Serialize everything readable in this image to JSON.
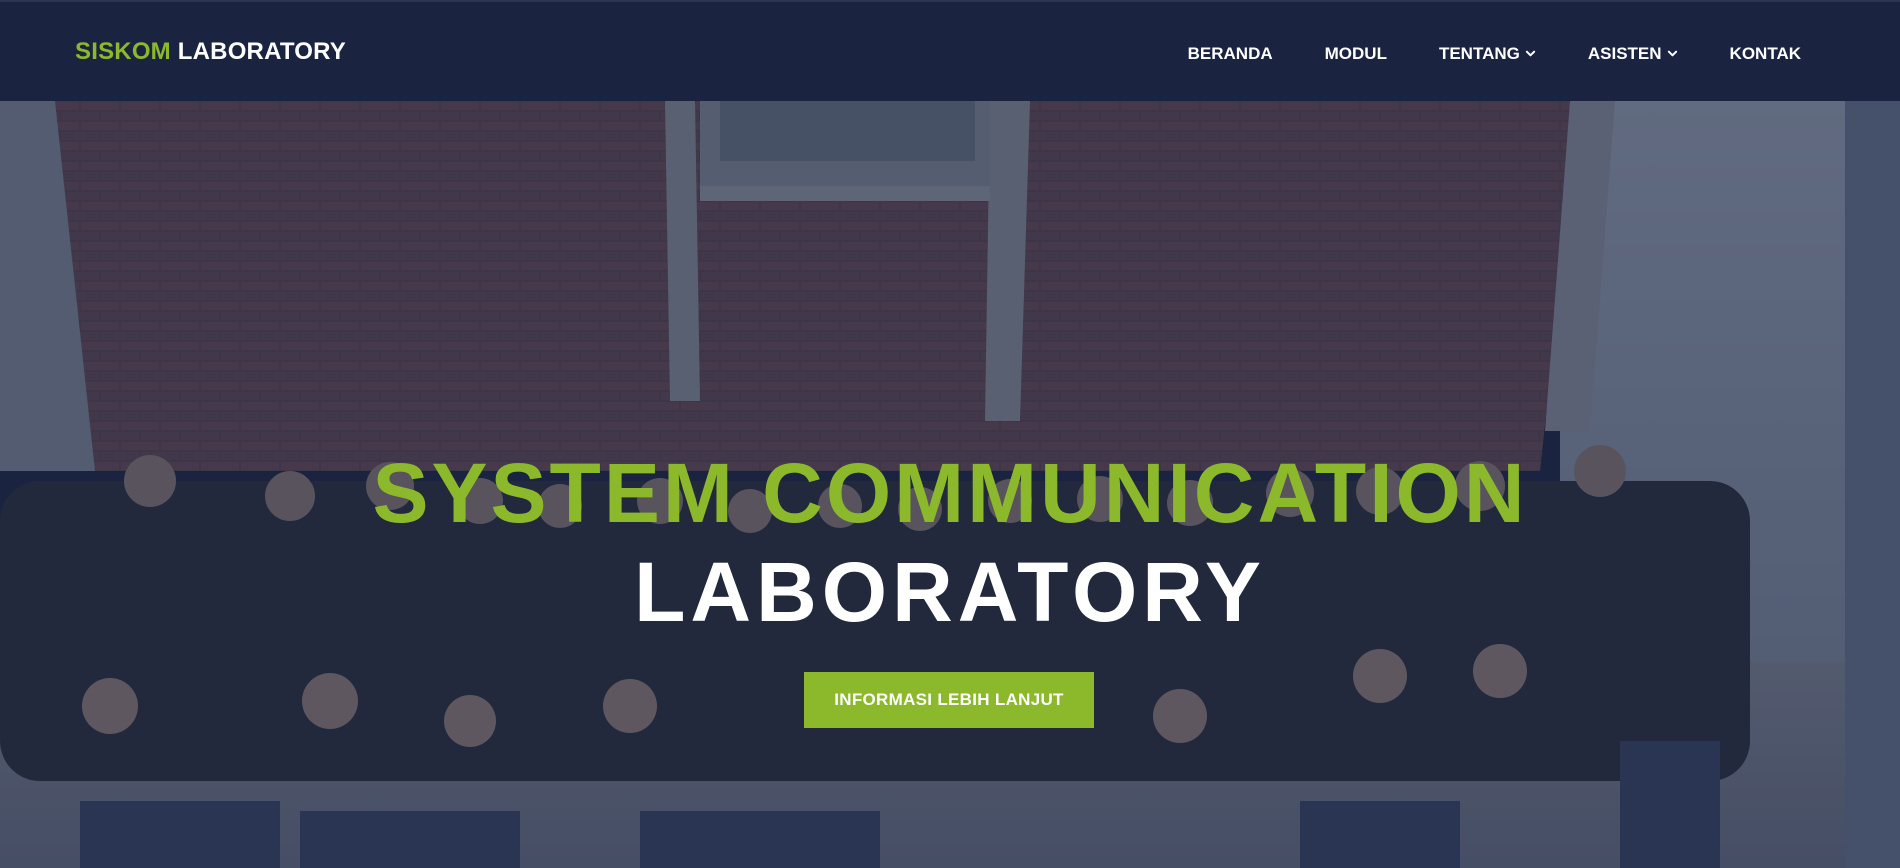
{
  "colors": {
    "accent": "#8cb82b",
    "navbar_bg": "#1a2441",
    "overlay": "#1a2441",
    "text": "#ffffff"
  },
  "brand": {
    "accent_text": "SISKOM",
    "text": "LABORATORY"
  },
  "nav": {
    "items": [
      {
        "label": "BERANDA",
        "has_dropdown": false
      },
      {
        "label": "MODUL",
        "has_dropdown": false
      },
      {
        "label": "TENTANG",
        "has_dropdown": true,
        "icon": "chevron-down-icon"
      },
      {
        "label": "ASISTEN",
        "has_dropdown": true,
        "icon": "chevron-down-icon"
      },
      {
        "label": "KONTAK",
        "has_dropdown": false
      }
    ]
  },
  "hero": {
    "title_line1": "SYSTEM COMMUNICATION",
    "title_line2": "LABORATORY",
    "cta_label": "INFORMASI LEBIH LANJUT"
  }
}
